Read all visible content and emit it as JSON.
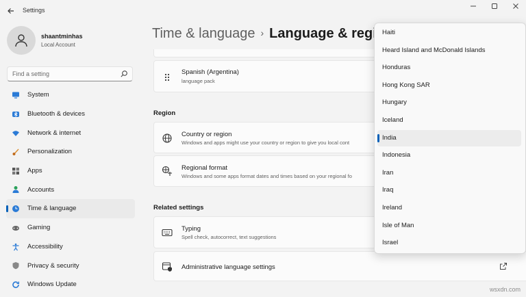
{
  "window": {
    "title": "Settings"
  },
  "profile": {
    "name": "shaantminhas",
    "account_type": "Local Account"
  },
  "search": {
    "placeholder": "Find a setting"
  },
  "sidebar": {
    "items": [
      {
        "label": "System",
        "icon": "monitor-icon",
        "color": "#2b7bd6"
      },
      {
        "label": "Bluetooth & devices",
        "icon": "bluetooth-icon",
        "color": "#2b7bd6"
      },
      {
        "label": "Network & internet",
        "icon": "wifi-icon",
        "color": "#2b7bd6"
      },
      {
        "label": "Personalization",
        "icon": "brush-icon",
        "color": "#d98a2b"
      },
      {
        "label": "Apps",
        "icon": "apps-icon",
        "color": "#555555"
      },
      {
        "label": "Accounts",
        "icon": "person-icon",
        "color": "#2aa15a"
      },
      {
        "label": "Time & language",
        "icon": "globe-clock-icon",
        "color": "#2b7bd6",
        "active": true
      },
      {
        "label": "Gaming",
        "icon": "controller-icon",
        "color": "#555555"
      },
      {
        "label": "Accessibility",
        "icon": "accessibility-icon",
        "color": "#2b7bd6"
      },
      {
        "label": "Privacy & security",
        "icon": "shield-icon",
        "color": "#777777"
      },
      {
        "label": "Windows Update",
        "icon": "update-icon",
        "color": "#2b7bd6"
      }
    ]
  },
  "header": {
    "parent": "Time & language",
    "separator": "›",
    "current": "Language & regio"
  },
  "content": {
    "language_item": {
      "title": "Spanish (Argentina)",
      "desc": "language pack"
    },
    "region_heading": "Region",
    "country": {
      "title": "Country or region",
      "desc": "Windows and apps might use your country or region to give you local cont"
    },
    "format": {
      "title": "Regional format",
      "desc": "Windows and some apps format dates and times based on your regional fo"
    },
    "related_heading": "Related settings",
    "typing": {
      "title": "Typing",
      "desc": "Spell check, autocorrect, text suggestions"
    },
    "admin": {
      "title": "Administrative language settings"
    }
  },
  "dropdown": {
    "options": [
      "Haiti",
      "Heard Island and McDonald Islands",
      "Honduras",
      "Hong Kong SAR",
      "Hungary",
      "Iceland",
      "India",
      "Indonesia",
      "Iran",
      "Iraq",
      "Ireland",
      "Isle of Man",
      "Israel"
    ],
    "selected": "India"
  },
  "watermark": "wsxdn.com",
  "colors": {
    "accent": "#005fb8"
  }
}
